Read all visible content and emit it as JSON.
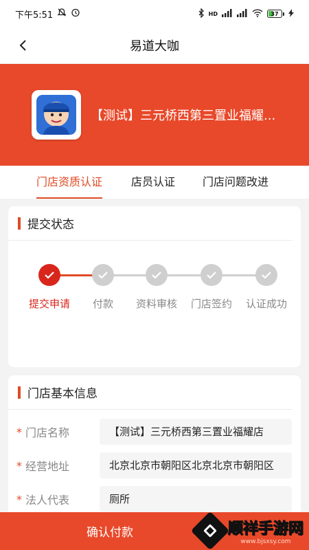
{
  "status_bar": {
    "time": "下午5:51",
    "network_label": "HD",
    "battery": "37"
  },
  "nav": {
    "title": "易道大咖"
  },
  "store": {
    "name": "【测试】三元桥西第三置业福耀..."
  },
  "tabs": [
    {
      "label": "门店资质认证",
      "active": true
    },
    {
      "label": "店员认证",
      "active": false
    },
    {
      "label": "门店问题改进",
      "active": false
    }
  ],
  "submit_status": {
    "title": "提交状态",
    "steps": [
      {
        "label": "提交申请",
        "done": true
      },
      {
        "label": "付款",
        "done": false
      },
      {
        "label": "资料审核",
        "done": false
      },
      {
        "label": "门店签约",
        "done": false
      },
      {
        "label": "认证成功",
        "done": false
      }
    ]
  },
  "store_info": {
    "title": "门店基本信息",
    "fields": [
      {
        "label": "门店名称",
        "value": "【测试】三元桥西第三置业福耀店"
      },
      {
        "label": "经营地址",
        "value": "北京北京市朝阳区北京北京市朝阳区"
      },
      {
        "label": "法人代表",
        "value": "厕所"
      }
    ]
  },
  "footer": {
    "confirm_label": "确认付款"
  },
  "watermark": {
    "name": "顺祥手游网",
    "url": "www.bjsxsy.com"
  },
  "colors": {
    "accent": "#e8492a",
    "step_done": "#d8261d",
    "step_pending": "#cfcfcf"
  }
}
